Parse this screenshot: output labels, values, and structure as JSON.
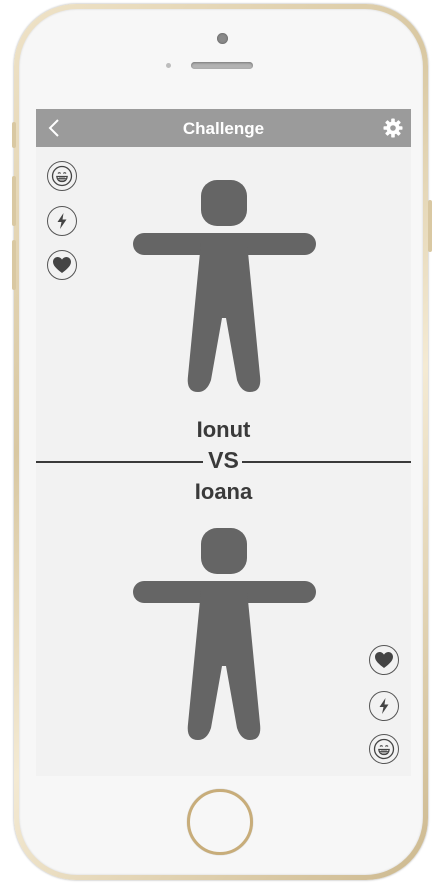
{
  "header": {
    "title": "Challenge"
  },
  "players": {
    "top_name": "Ionut",
    "bottom_name": "Ioana",
    "vs_label": "VS"
  },
  "icons": {
    "back": "chevron-left-icon",
    "settings": "gear-icon",
    "emoji": "grinning-face-icon",
    "bolt": "lightning-icon",
    "heart": "heart-icon",
    "avatar": "person-silhouette-icon"
  },
  "colors": {
    "header_bg": "#9b9b9b",
    "screen_bg": "#f2f2f2",
    "figure": "#656565",
    "text": "#3a3a3a",
    "phone_frame": "#d9c8a2"
  }
}
